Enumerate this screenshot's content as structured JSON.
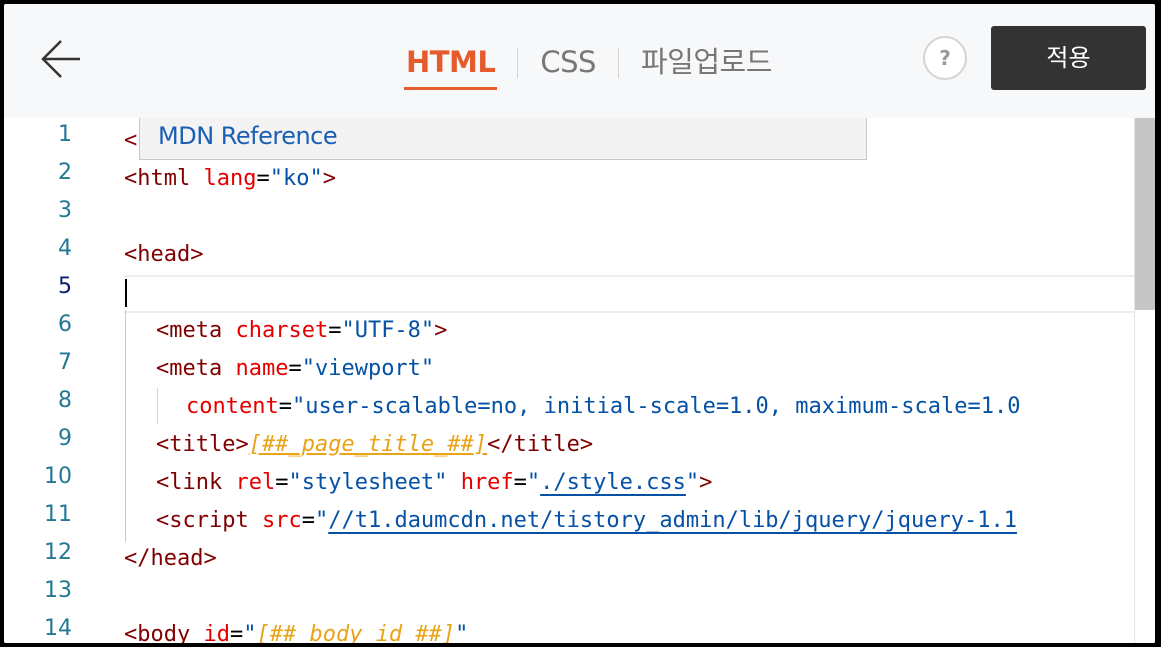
{
  "header": {
    "back_icon": "arrow-left-icon",
    "tabs": [
      {
        "label": "HTML",
        "active": true
      },
      {
        "label": "CSS",
        "active": false
      },
      {
        "label": "파일업로드",
        "active": false
      }
    ],
    "help_label": "?",
    "apply_label": "적용"
  },
  "editor": {
    "tooltip": "MDN Reference",
    "line_numbers": [
      "1",
      "2",
      "3",
      "4",
      "5",
      "6",
      "7",
      "8",
      "9",
      "10",
      "11",
      "12",
      "13",
      "14"
    ],
    "current_line": "5",
    "lines": {
      "l1": {
        "open": "<"
      },
      "l2": {
        "open": "<html",
        "attr": "lang",
        "eq": "=",
        "val": "\"ko\"",
        "close": ">"
      },
      "l4": {
        "tag": "<head>"
      },
      "l6": {
        "open": "<meta",
        "attr": "charset",
        "eq": "=",
        "val": "\"UTF-8\"",
        "close": ">"
      },
      "l7": {
        "open": "<meta",
        "attr": "name",
        "eq": "=",
        "val": "\"viewport\""
      },
      "l8": {
        "attr": "content",
        "eq": "=",
        "val": "\"user-scalable=no, initial-scale=1.0, maximum-scale=1.0"
      },
      "l9": {
        "open": "<title>",
        "tpl": "[##_page_title_##]",
        "close": "</title>"
      },
      "l10": {
        "open": "<link",
        "attr1": "rel",
        "eq1": "=",
        "val1": "\"stylesheet\"",
        "attr2": "href",
        "eq2": "=",
        "q": "\"",
        "val2": "./style.css",
        "q2": "\"",
        "close": ">"
      },
      "l11": {
        "open": "<script",
        "attr": "src",
        "eq": "=",
        "q": "\"",
        "val": "//t1.daumcdn.net/tistory_admin/lib/jquery/jquery-1.1"
      },
      "l12": {
        "tag": "</head>"
      },
      "l14": {
        "open": "<body",
        "attr": "id",
        "eq": "=",
        "q": "\"",
        "tpl": "[##_body_id_##]",
        "q2": "\""
      }
    }
  },
  "colors": {
    "accent": "#e55b2b",
    "apply_bg": "#333333",
    "line_number": "#237893",
    "tag": "#800000",
    "attribute": "#e50000",
    "value": "#0451a5",
    "template": "#e8a317"
  }
}
